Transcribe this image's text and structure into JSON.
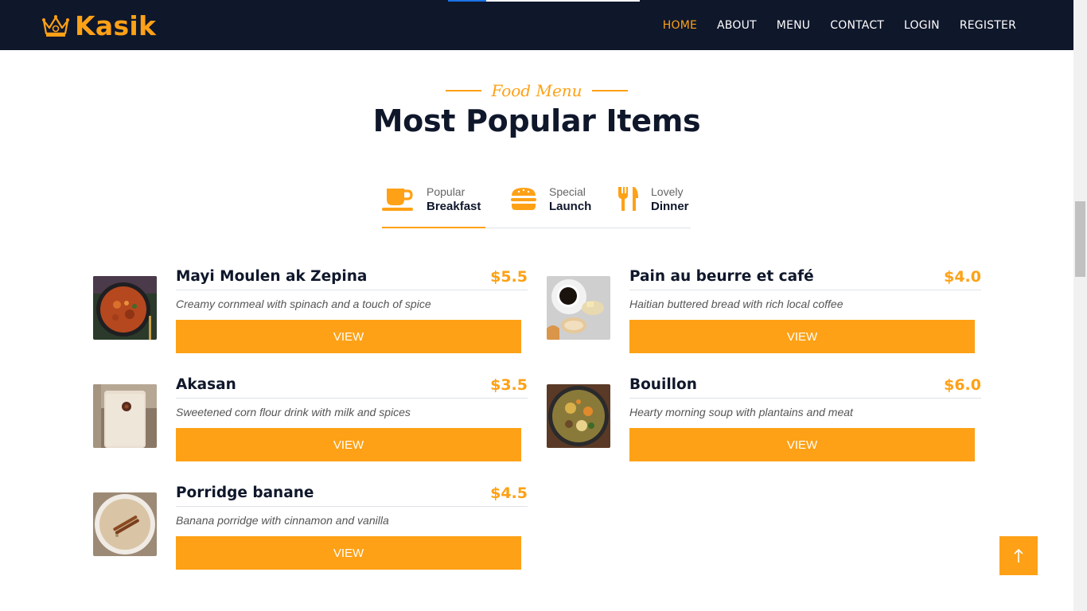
{
  "brand": {
    "name": "Kasik",
    "icon": "crown-icon"
  },
  "nav": [
    {
      "label": "HOME",
      "active": true
    },
    {
      "label": "ABOUT",
      "active": false
    },
    {
      "label": "MENU",
      "active": false
    },
    {
      "label": "CONTACT",
      "active": false
    },
    {
      "label": "LOGIN",
      "active": false
    },
    {
      "label": "REGISTER",
      "active": false
    }
  ],
  "section": {
    "subtitle": "Food Menu",
    "title": "Most Popular Items"
  },
  "tabs": [
    {
      "small": "Popular",
      "big": "Breakfast",
      "icon": "coffee-cup-icon",
      "active": true
    },
    {
      "small": "Special",
      "big": "Launch",
      "icon": "hamburger-icon",
      "active": false
    },
    {
      "small": "Lovely",
      "big": "Dinner",
      "icon": "utensils-icon",
      "active": false
    }
  ],
  "items": [
    {
      "name": "Mayi Moulen ak Zepina",
      "price": "$5.5",
      "desc": "Creamy cornmeal with spinach and a touch of spice",
      "button": "VIEW"
    },
    {
      "name": "Pain au beurre et café",
      "price": "$4.0",
      "desc": "Haitian buttered bread with rich local coffee",
      "button": "VIEW"
    },
    {
      "name": "Akasan",
      "price": "$3.5",
      "desc": "Sweetened corn flour drink with milk and spices",
      "button": "VIEW"
    },
    {
      "name": "Bouillon",
      "price": "$6.0",
      "desc": "Hearty morning soup with plantains and meat",
      "button": "VIEW"
    },
    {
      "name": "Porridge banane",
      "price": "$4.5",
      "desc": "Banana porridge with cinnamon and vanilla",
      "button": "VIEW"
    }
  ],
  "colors": {
    "primary": "#fea116",
    "dark": "#0f172b"
  },
  "back_to_top": {
    "icon": "arrow-up-icon"
  }
}
